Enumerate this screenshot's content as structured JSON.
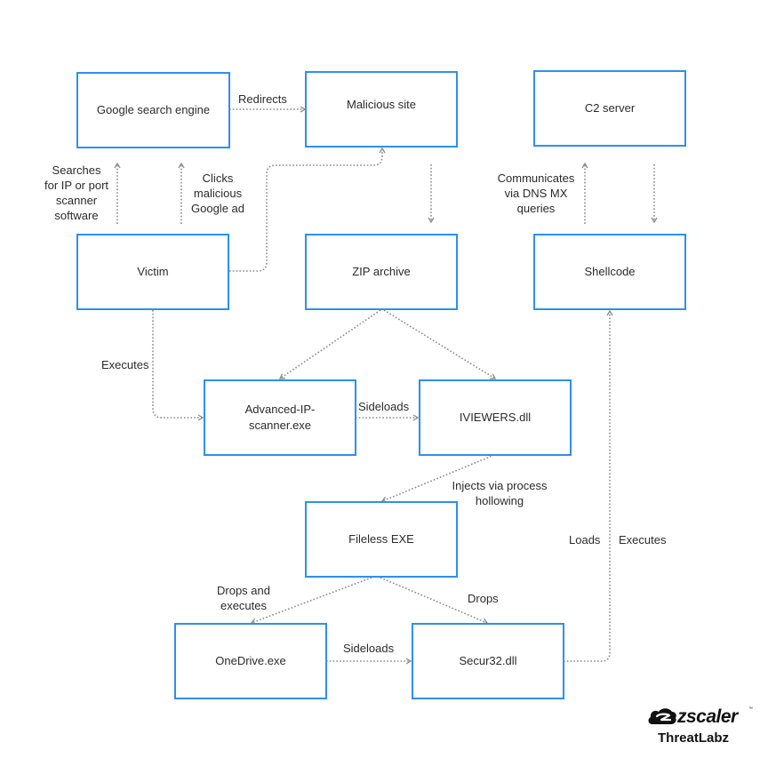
{
  "diagram": {
    "nodes": {
      "google": "Google search engine",
      "malicious_site": "Malicious site",
      "c2": "C2 server",
      "victim": "Victim",
      "zip": "ZIP archive",
      "shellcode": "Shellcode",
      "scanner_line1": "Advanced-IP-",
      "scanner_line2": "scanner.exe",
      "iviewers": "IVIEWERS.dll",
      "fileless": "Fileless EXE",
      "onedrive": "OneDrive.exe",
      "secur32": "Secur32.dll"
    },
    "edges": {
      "redirects": "Redirects",
      "searches": [
        "Searches",
        "for IP or port",
        "scanner",
        "software"
      ],
      "clicks": [
        "Clicks",
        "malicious",
        "Google ad"
      ],
      "communicates": [
        "Communicates",
        "via DNS MX",
        "queries"
      ],
      "executes_victim": "Executes",
      "sideloads_1": "Sideloads",
      "injects": [
        "Injects via process",
        "hollowing"
      ],
      "loads": "Loads",
      "executes_shellcode": "Executes",
      "drops_and_executes": [
        "Drops and",
        "executes"
      ],
      "drops": "Drops",
      "sideloads_2": "Sideloads"
    }
  },
  "branding": {
    "brand": "zscaler",
    "trademark": "™",
    "sub": "ThreatLabz"
  },
  "colors": {
    "node_border": "#2f8ef0",
    "edge": "#8a8a8a",
    "text": "#2b2b2b"
  }
}
